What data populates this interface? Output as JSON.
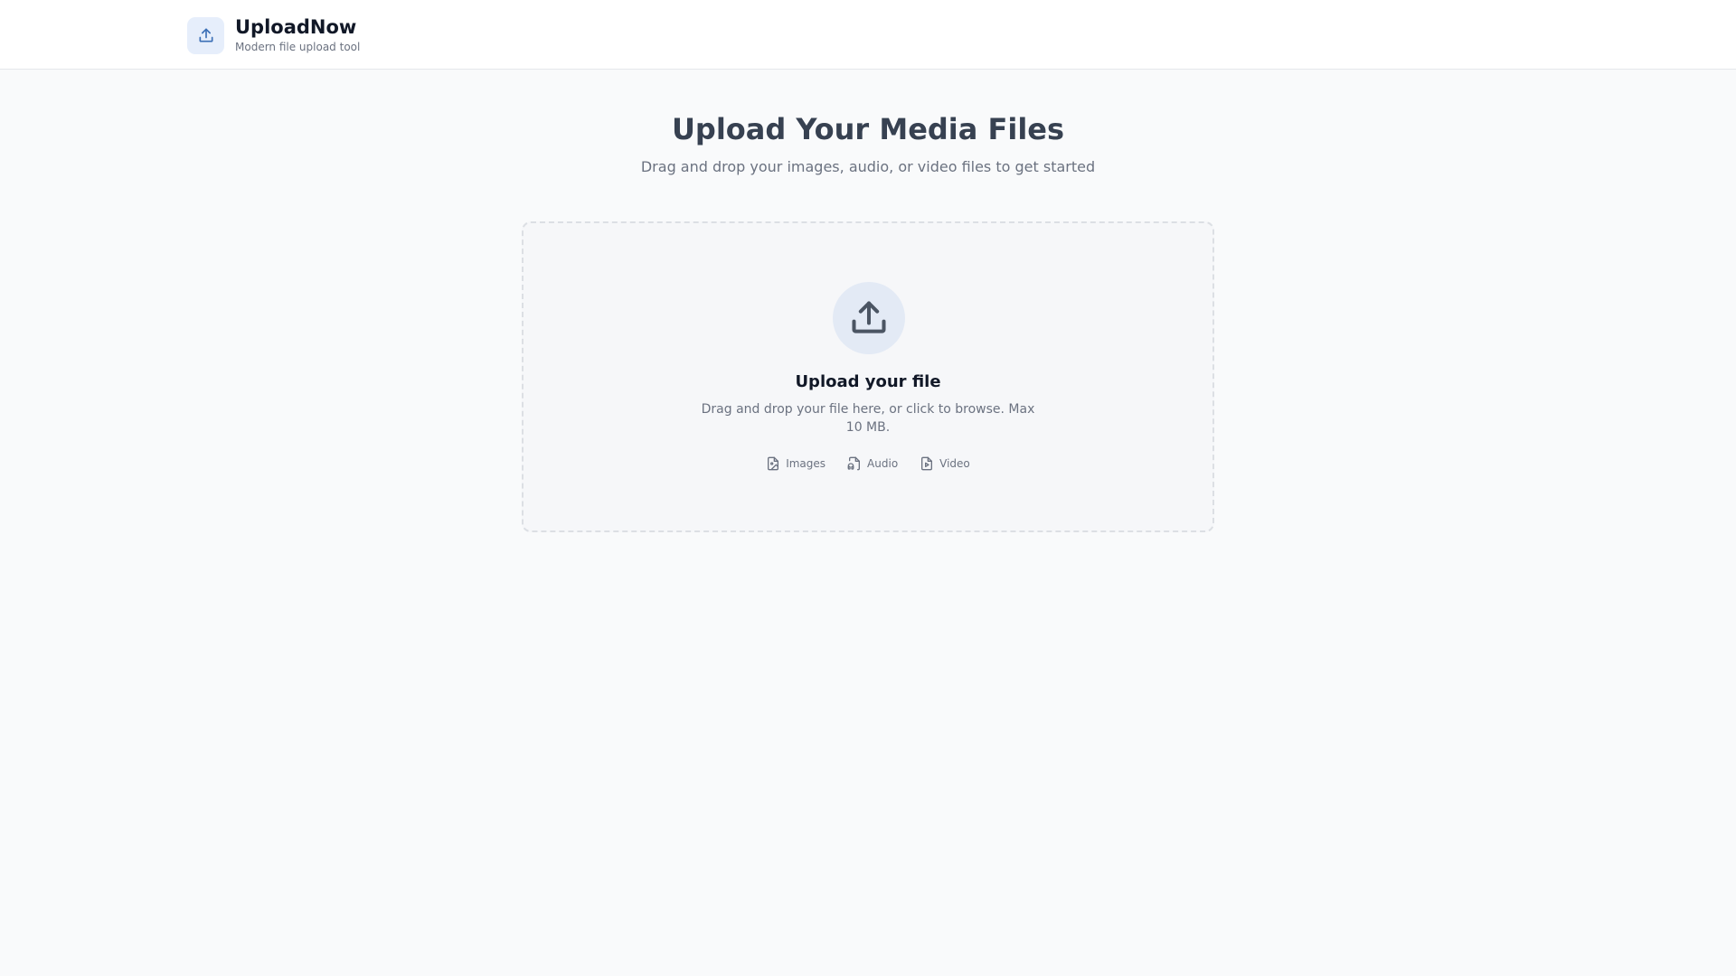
{
  "header": {
    "app_name": "UploadNow",
    "tagline": "Modern file upload tool",
    "logo_icon": "upload-icon"
  },
  "main": {
    "title": "Upload Your Media Files",
    "subtitle": "Drag and drop your images, audio, or video files to get started"
  },
  "dropzone": {
    "icon": "upload-icon",
    "title": "Upload your file",
    "description": "Drag and drop your file here, or click to browse. Max 10 MB.",
    "types": [
      {
        "label": "Images",
        "icon": "image-file-icon"
      },
      {
        "label": "Audio",
        "icon": "audio-file-icon"
      },
      {
        "label": "Video",
        "icon": "video-file-icon"
      }
    ]
  },
  "colors": {
    "accent": "#3b6fb6",
    "icon_gray": "#4b5563",
    "page_bg": "#f9fafb"
  }
}
